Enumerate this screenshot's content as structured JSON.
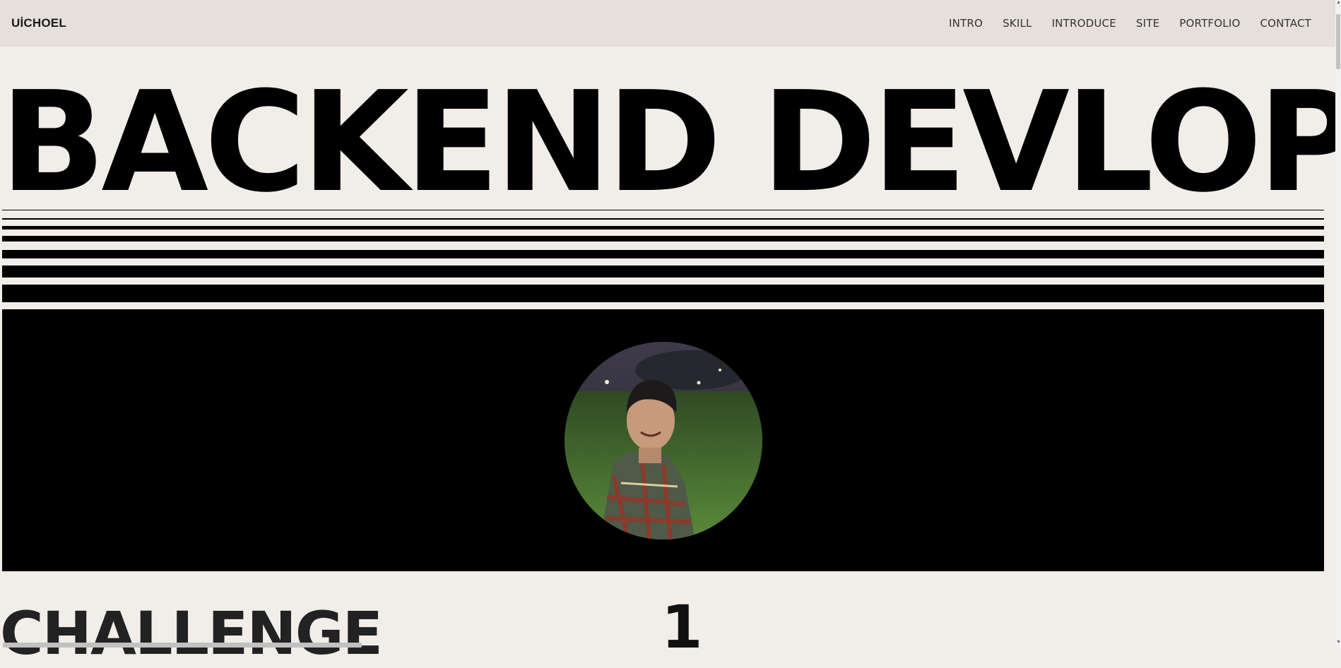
{
  "header": {
    "logo": "UİCHOEL",
    "nav": [
      "INTRO",
      "SKILL",
      "INTRODUCE",
      "SITE",
      "PORTFOLIO",
      "CONTACT"
    ]
  },
  "hero": {
    "title": "BACKEND DEVLOP"
  },
  "profile": {
    "photo": "profile-photo"
  },
  "section": {
    "heading": "CHALLENGE",
    "number": "1"
  },
  "colors": {
    "background": "#f1ede8",
    "header": "#e6e0dc",
    "ink": "#000000"
  }
}
